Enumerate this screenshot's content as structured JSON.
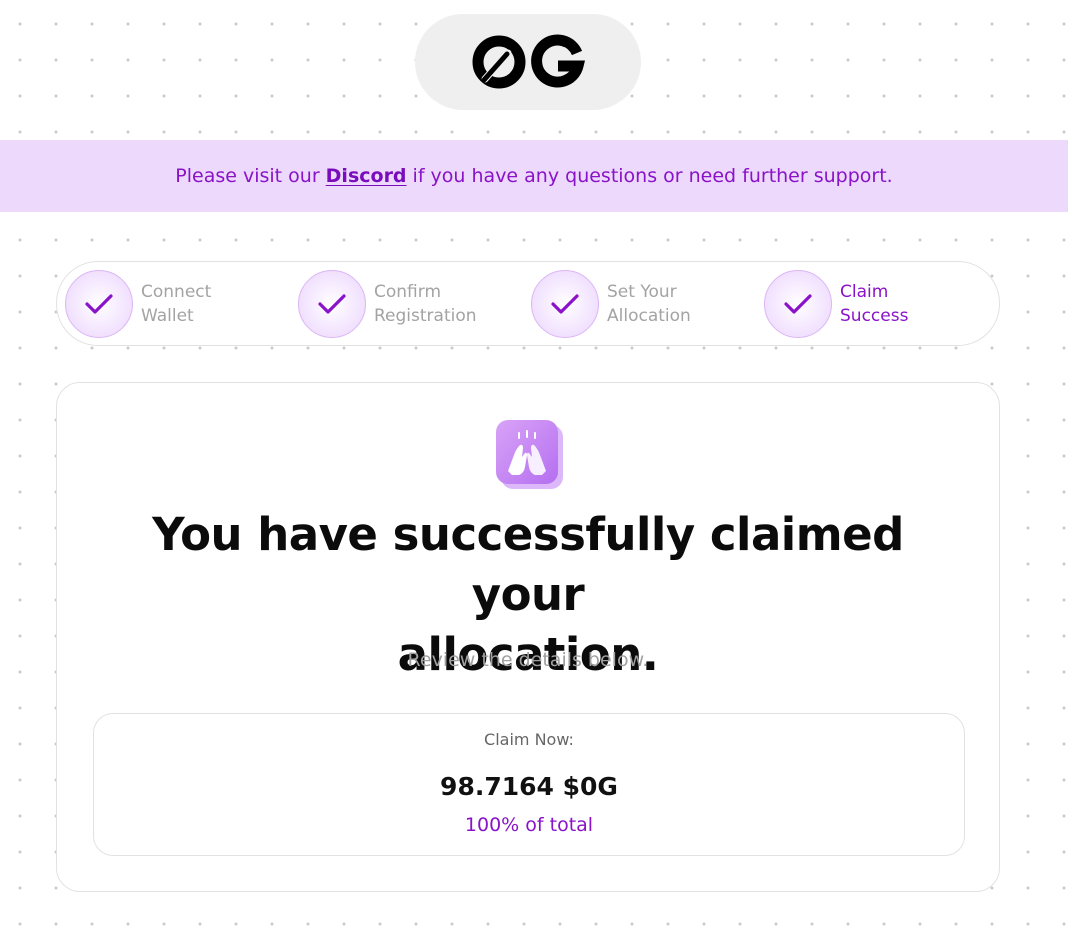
{
  "header": {
    "logo_icon": "0g-logo"
  },
  "banner": {
    "text_before": "Please visit our",
    "link_label": "Discord",
    "text_after": "if you have any questions or need further support."
  },
  "steps": [
    {
      "line1": "Connect",
      "line2": "Wallet",
      "icon": "check-icon",
      "state": "complete"
    },
    {
      "line1": "Confirm",
      "line2": "Registration",
      "icon": "check-icon",
      "state": "complete"
    },
    {
      "line1": "Set Your",
      "line2": "Allocation",
      "icon": "check-icon",
      "state": "complete"
    },
    {
      "line1": "Claim",
      "line2": "Success",
      "icon": "check-icon",
      "state": "current"
    }
  ],
  "success": {
    "icon": "high-five-hands-icon",
    "headline_line1": "You have successfully claimed your",
    "headline_line2": "allocation.",
    "subtext": "Review the details below."
  },
  "claim": {
    "label": "Claim Now:",
    "amount": "98.7164 $0G",
    "percent": "100% of total"
  },
  "colors": {
    "accent": "#8a12c9",
    "banner_bg": "#ecd9fb",
    "muted_text": "#a3a3a3"
  }
}
